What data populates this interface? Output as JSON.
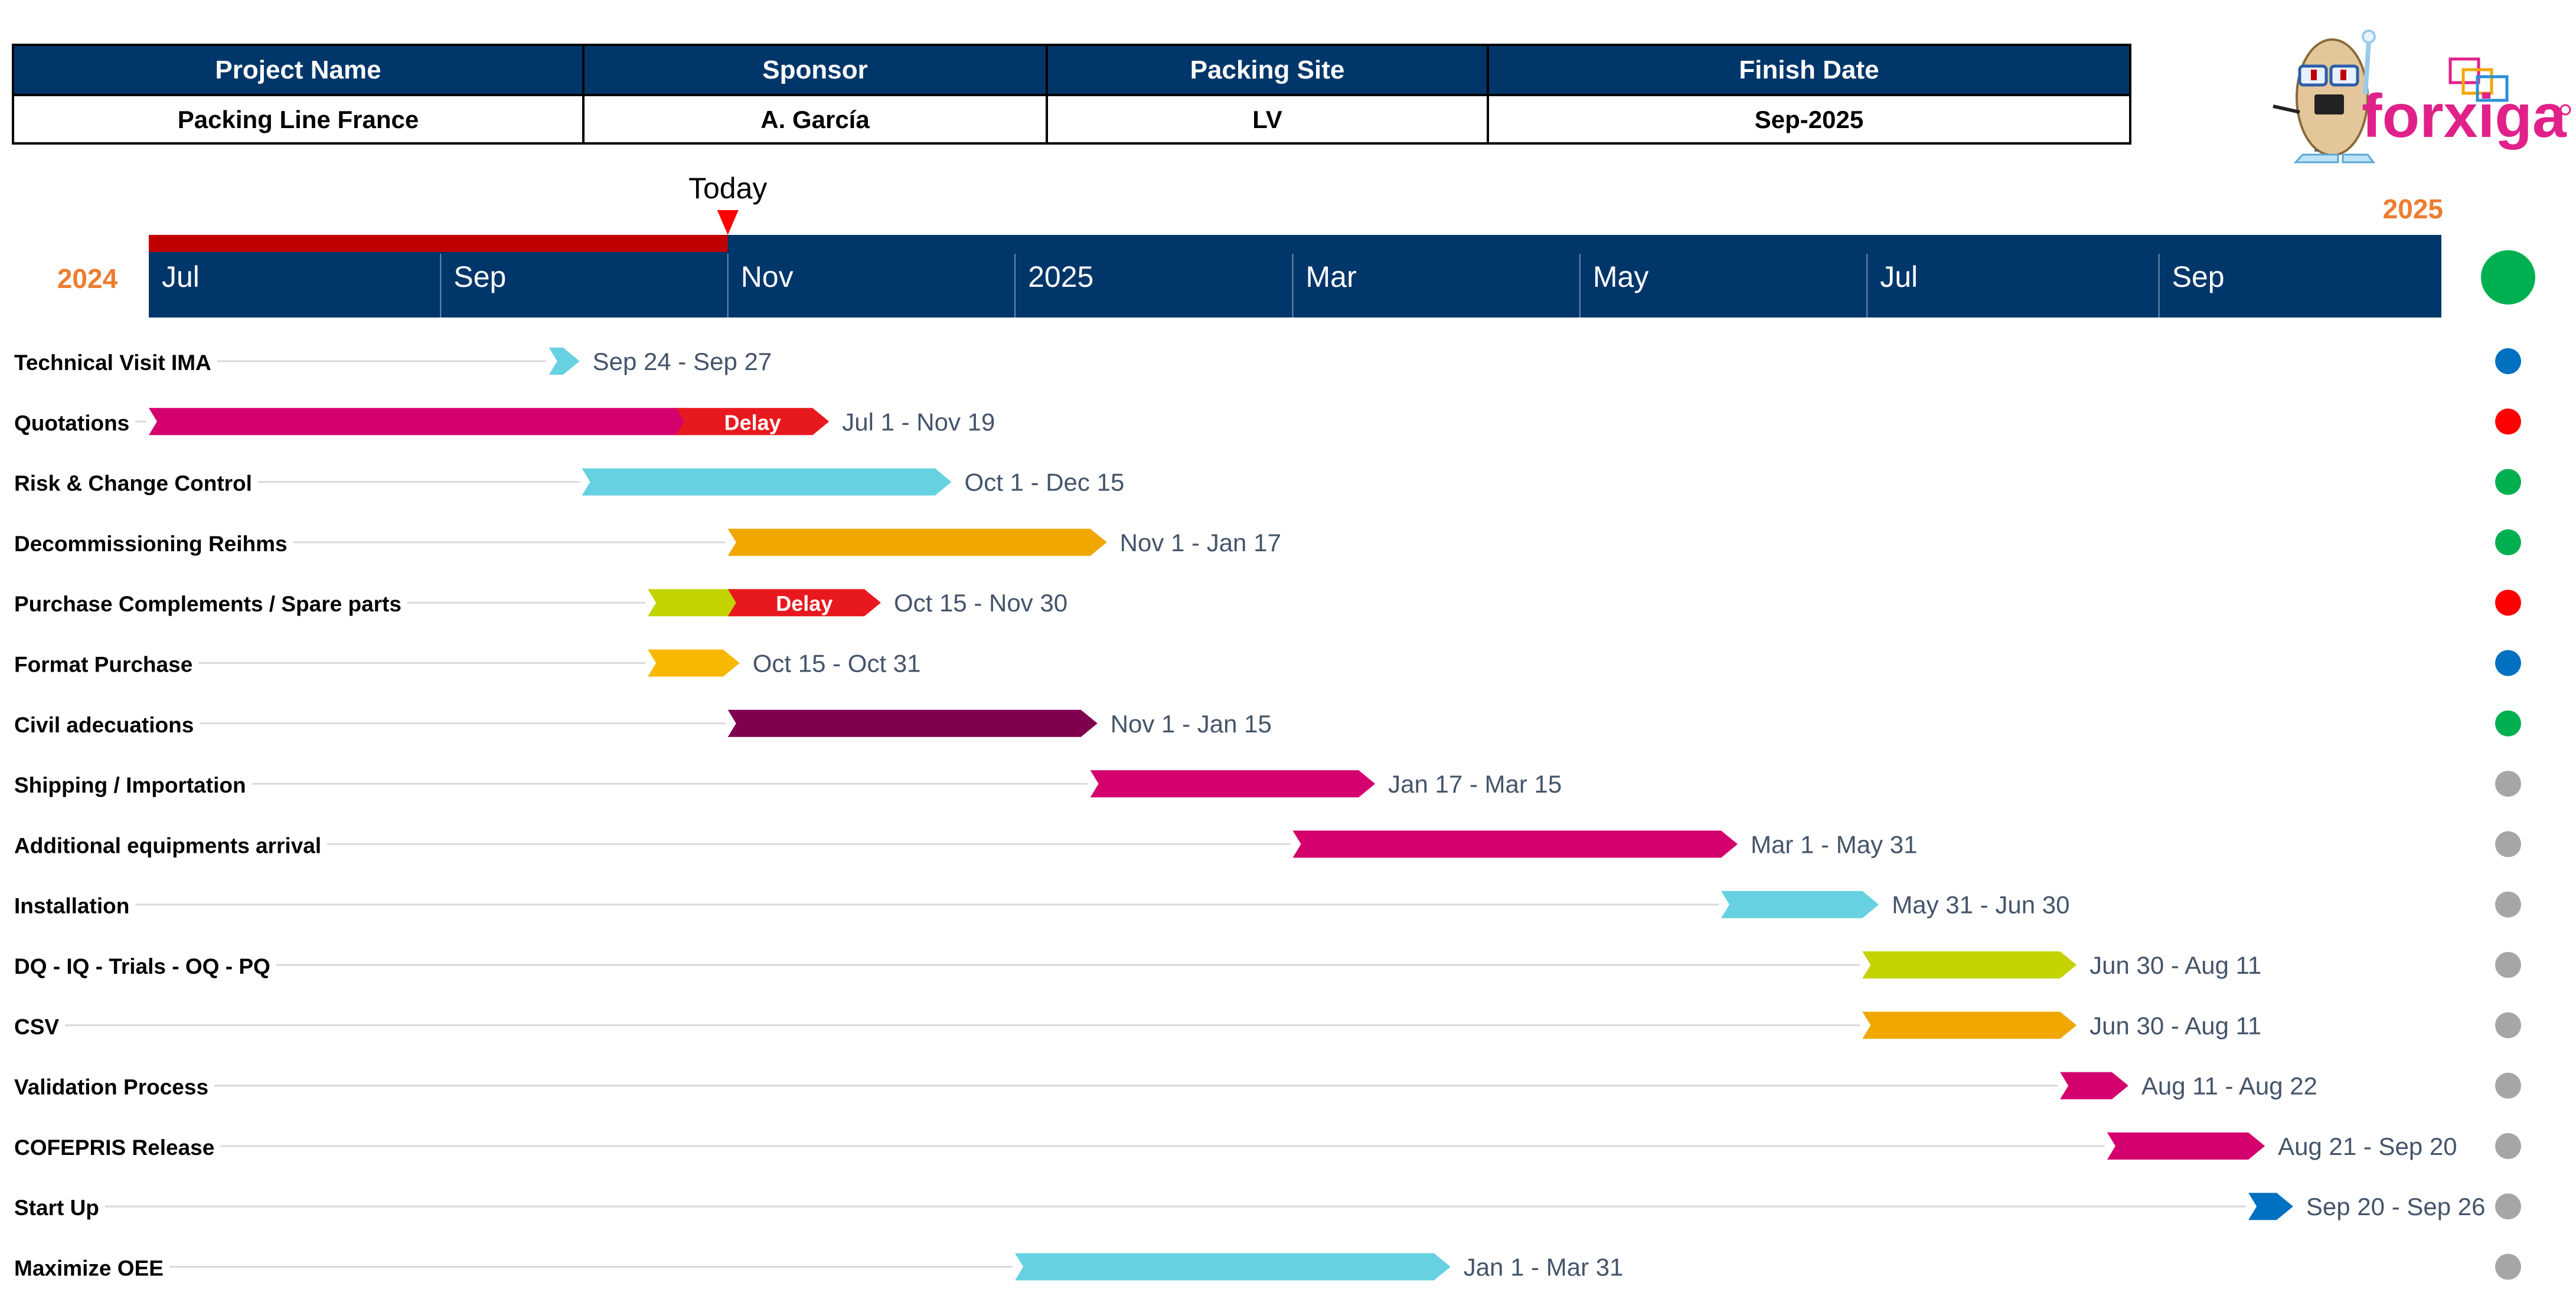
{
  "header_table": {
    "headers": [
      "Project Name",
      "Sponsor",
      "Packing Site",
      "Finish Date"
    ],
    "values": [
      "Packing Line France",
      "A. García",
      "LV",
      "Sep-2025"
    ],
    "header_bg": "#00366A"
  },
  "logo": {
    "brand": "forxiga",
    "mascot_icon": "mascot-icon",
    "mark_icon": "overlapping-squares-icon",
    "brand_color": "#E0218A"
  },
  "chart_data": {
    "type": "gantt",
    "today_label": "Today",
    "today_date": "2024-11-01",
    "progress_color": "#C00000",
    "timeline_bg": "#00366A",
    "year_labels": {
      "start": "2024",
      "end": "2025",
      "color": "#ED7D31"
    },
    "axis": {
      "start": "2024-07-01",
      "end": "2025-10-31",
      "ticks": [
        {
          "date": "2024-07-01",
          "label": "Jul"
        },
        {
          "date": "2024-09-01",
          "label": "Sep"
        },
        {
          "date": "2024-11-01",
          "label": "Nov"
        },
        {
          "date": "2025-01-01",
          "label": "2025"
        },
        {
          "date": "2025-03-01",
          "label": "Mar"
        },
        {
          "date": "2025-05-01",
          "label": "May"
        },
        {
          "date": "2025-07-01",
          "label": "Jul"
        },
        {
          "date": "2025-09-01",
          "label": "Sep"
        }
      ]
    },
    "overall_status_color": "#00B050",
    "tasks": [
      {
        "name": "Technical Visit IMA",
        "start": "2024-09-24",
        "end": "2024-09-27",
        "label": "Sep 24 - Sep 27",
        "color": "#66D1E0",
        "status": "#0070C0"
      },
      {
        "name": "Quotations",
        "start": "2024-07-01",
        "end": "2024-11-19",
        "label": "Jul 1 - Nov 19",
        "color": "#D4006E",
        "status": "#FF0000",
        "delay": {
          "start": "2024-10-21",
          "label": "Delay",
          "color": "#E8191E"
        }
      },
      {
        "name": "Risk & Change Control",
        "start": "2024-10-01",
        "end": "2024-12-15",
        "label": "Oct 1 - Dec 15",
        "color": "#66D1E0",
        "status": "#00B050"
      },
      {
        "name": "Decommissioning Reihms",
        "start": "2024-11-01",
        "end": "2025-01-17",
        "label": "Nov 1 - Jan 17",
        "color": "#F0A800",
        "status": "#00B050"
      },
      {
        "name": "Purchase Complements / Spare parts",
        "start": "2024-10-15",
        "end": "2024-11-30",
        "label": "Oct 15 - Nov 30",
        "color": "#C3D300",
        "status": "#FF0000",
        "delay": {
          "start": "2024-11-01",
          "label": "Delay",
          "color": "#E8191E"
        }
      },
      {
        "name": "Format Purchase",
        "start": "2024-10-15",
        "end": "2024-10-31",
        "label": "Oct 15 - Oct 31",
        "color": "#F7B900",
        "status": "#0070C0"
      },
      {
        "name": "Civil adecuations",
        "start": "2024-11-01",
        "end": "2025-01-15",
        "label": "Nov 1 - Jan 15",
        "color": "#800050",
        "status": "#00B050"
      },
      {
        "name": "Shipping / Importation",
        "start": "2025-01-17",
        "end": "2025-03-15",
        "label": "Jan 17 - Mar 15",
        "color": "#D4006E",
        "status": "#A6A6A6"
      },
      {
        "name": "Additional equipments arrival",
        "start": "2025-03-01",
        "end": "2025-05-31",
        "label": "Mar 1 - May 31",
        "color": "#D4006E",
        "status": "#A6A6A6"
      },
      {
        "name": "Installation",
        "start": "2025-05-31",
        "end": "2025-06-30",
        "label": "May 31 - Jun 30",
        "color": "#66D1E0",
        "status": "#A6A6A6"
      },
      {
        "name": "DQ - IQ - Trials - OQ - PQ",
        "start": "2025-06-30",
        "end": "2025-08-11",
        "label": "Jun 30 - Aug 11",
        "color": "#C3D300",
        "status": "#A6A6A6"
      },
      {
        "name": "CSV",
        "start": "2025-06-30",
        "end": "2025-08-11",
        "label": "Jun 30 - Aug 11",
        "color": "#F0A800",
        "status": "#A6A6A6"
      },
      {
        "name": "Validation Process",
        "start": "2025-08-11",
        "end": "2025-08-22",
        "label": "Aug 11 - Aug 22",
        "color": "#D4006E",
        "status": "#A6A6A6"
      },
      {
        "name": "COFEPRIS Release",
        "start": "2025-08-21",
        "end": "2025-09-20",
        "label": "Aug 21 - Sep 20",
        "color": "#D4006E",
        "status": "#A6A6A6"
      },
      {
        "name": "Start Up",
        "start": "2025-09-20",
        "end": "2025-09-26",
        "label": "Sep 20 - Sep 26",
        "color": "#0070C0",
        "status": "#A6A6A6"
      },
      {
        "name": "Maximize OEE",
        "start": "2025-01-01",
        "end": "2025-03-31",
        "label": "Jan 1 - Mar 31",
        "color": "#66D1E0",
        "status": "#A6A6A6"
      }
    ]
  }
}
